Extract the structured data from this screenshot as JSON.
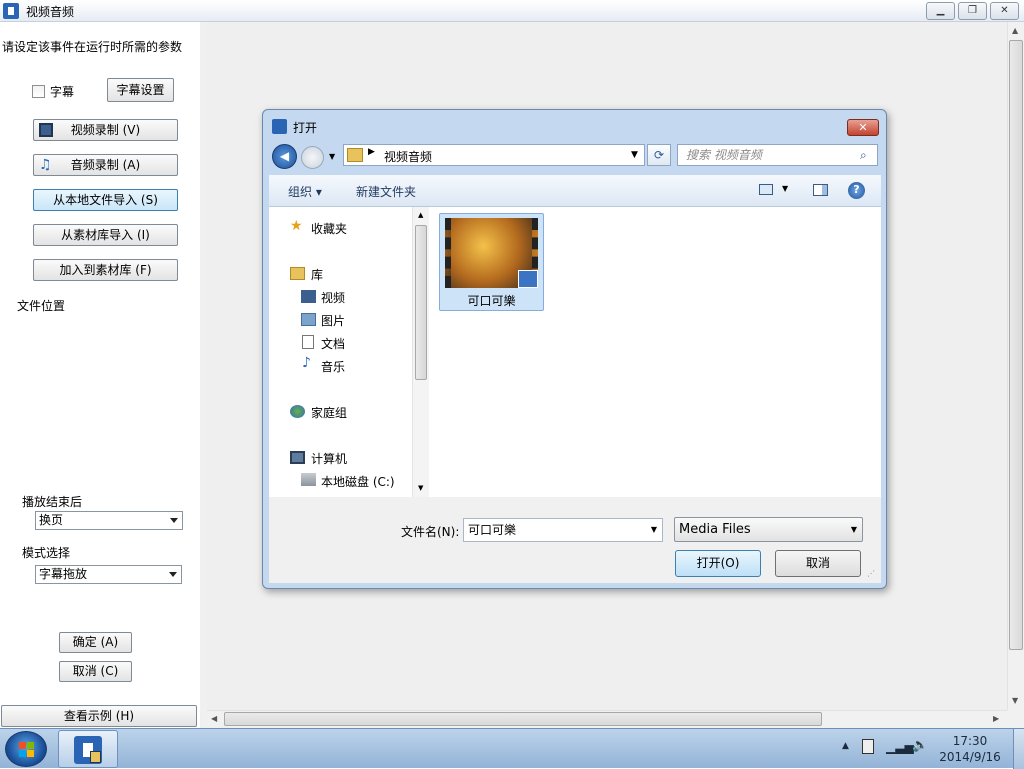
{
  "window": {
    "title": "视频音频"
  },
  "left_panel": {
    "instruction": "请设定该事件在运行时所需的参数",
    "subtitle_checkbox_label": "字幕",
    "subtitle_checked": false,
    "subtitle_settings_button": "字幕设置",
    "buttons": [
      "视频录制 (V)",
      "音频录制 (A)",
      "从本地文件导入 (S)",
      "从素材库导入 (I)",
      "加入到素材库 (F)"
    ],
    "file_location_label": "文件位置",
    "after_play_label": "播放结束后",
    "after_play_value": "换页",
    "mode_label": "模式选择",
    "mode_value": "字幕拖放",
    "ok_button": "确定 (A)",
    "cancel_button": "取消 (C)",
    "example_button": "查看示例 (H)"
  },
  "dialog": {
    "title": "打开",
    "address": "视频音频",
    "search_placeholder": "搜索 视频音频",
    "toolbar": {
      "organize": "组织 ▾",
      "new_folder": "新建文件夹"
    },
    "nav": {
      "favorites": "收藏夹",
      "libraries": "库",
      "lib_items": [
        "视频",
        "图片",
        "文档",
        "音乐"
      ],
      "homegroup": "家庭组",
      "computer": "计算机",
      "local_disk": "本地磁盘 (C:)"
    },
    "file": {
      "name": "可口可樂"
    },
    "filename_label": "文件名(N):",
    "filename_value": "可口可樂",
    "filetype_value": "Media Files",
    "open_button": "打开(O)",
    "cancel_button": "取消"
  },
  "taskbar": {
    "time": "17:30",
    "date": "2014/9/16"
  }
}
